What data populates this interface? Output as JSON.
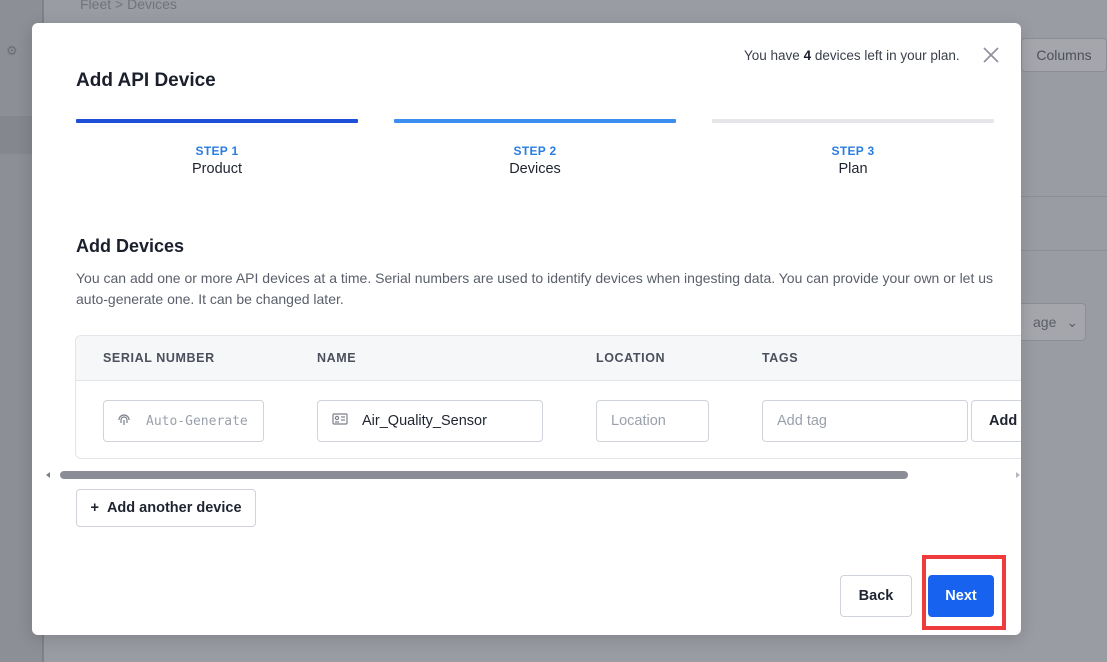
{
  "background": {
    "breadcrumb": "Fleet  >  Devices",
    "columns_label": "Columns",
    "page_label": "age"
  },
  "modal": {
    "title": "Add API Device",
    "plan_notice_prefix": "You have ",
    "plan_notice_count": "4",
    "plan_notice_suffix": " devices left in your plan.",
    "steps": [
      {
        "kicker": "STEP 1",
        "name": "Product",
        "bar_color": "#1f4fd8"
      },
      {
        "kicker": "STEP 2",
        "name": "Devices",
        "bar_color": "#3b8ef0"
      },
      {
        "kicker": "STEP 3",
        "name": "Plan",
        "bar_color": "#e4e6ea"
      }
    ],
    "section_title": "Add Devices",
    "section_desc": "You can add one or more API devices at a time. Serial numbers are used to identify devices when ingesting data. You can provide your own or let us auto-generate one. It can be changed later.",
    "table": {
      "headers": [
        "SERIAL NUMBER",
        "NAME",
        "LOCATION",
        "TAGS"
      ],
      "row": {
        "serial_placeholder": "Auto-Generate",
        "name_value": "Air_Quality_Sensor",
        "location_placeholder": "Location",
        "tag_placeholder": "Add tag",
        "add_tag_label": "Add"
      }
    },
    "add_device_label": "Add another device",
    "back_label": "Back",
    "next_label": "Next"
  },
  "colors": {
    "accent": "#1763f0",
    "highlight": "#ef3b3b"
  }
}
